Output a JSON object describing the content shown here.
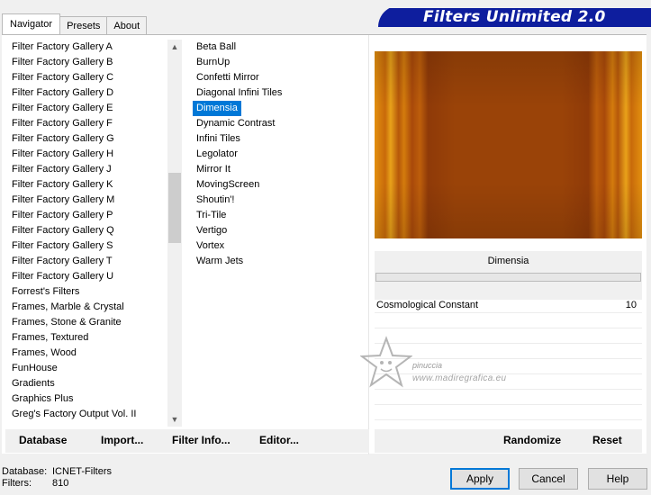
{
  "tabs": [
    {
      "label": "Navigator",
      "active": true
    },
    {
      "label": "Presets",
      "active": false
    },
    {
      "label": "About",
      "active": false
    }
  ],
  "banner": {
    "title": "Filters Unlimited 2.0",
    "color": "#0e1e9e"
  },
  "categories": [
    "Filter Factory Gallery A",
    "Filter Factory Gallery B",
    "Filter Factory Gallery C",
    "Filter Factory Gallery D",
    "Filter Factory Gallery E",
    "Filter Factory Gallery F",
    "Filter Factory Gallery G",
    "Filter Factory Gallery H",
    "Filter Factory Gallery J",
    "Filter Factory Gallery K",
    "Filter Factory Gallery M",
    "Filter Factory Gallery P",
    "Filter Factory Gallery Q",
    "Filter Factory Gallery S",
    "Filter Factory Gallery T",
    "Filter Factory Gallery U",
    "Forrest's Filters",
    "Frames, Marble & Crystal",
    "Frames, Stone & Granite",
    "Frames, Textured",
    "Frames, Wood",
    "FunHouse",
    "Gradients",
    "Graphics Plus",
    "Greg's Factory Output Vol. II"
  ],
  "filters": [
    {
      "label": "Beta Ball",
      "selected": false
    },
    {
      "label": "BurnUp",
      "selected": false
    },
    {
      "label": "Confetti Mirror",
      "selected": false
    },
    {
      "label": "Diagonal Infini Tiles",
      "selected": false
    },
    {
      "label": "Dimensia",
      "selected": true
    },
    {
      "label": "Dynamic Contrast",
      "selected": false
    },
    {
      "label": "Infini Tiles",
      "selected": false
    },
    {
      "label": "Legolator",
      "selected": false
    },
    {
      "label": "Mirror It",
      "selected": false
    },
    {
      "label": "MovingScreen",
      "selected": false
    },
    {
      "label": "Shoutin'!",
      "selected": false
    },
    {
      "label": "Tri-Tile",
      "selected": false
    },
    {
      "label": "Vertigo",
      "selected": false
    },
    {
      "label": "Vortex",
      "selected": false
    },
    {
      "label": "Warm Jets",
      "selected": false
    }
  ],
  "selected_filter": {
    "name": "Dimensia"
  },
  "parameters": [
    {
      "name": "Cosmological Constant",
      "value": "10"
    }
  ],
  "watermark": {
    "name": "pinuccia",
    "url": "www.madiregrafica.eu"
  },
  "left_bar": {
    "database": "Database",
    "import": "Import...",
    "filter_info": "Filter Info...",
    "editor": "Editor..."
  },
  "right_bar": {
    "randomize": "Randomize",
    "reset": "Reset"
  },
  "footer": {
    "database_label": "Database:",
    "database_value": "ICNET-Filters",
    "filters_label": "Filters:",
    "filters_value": "810"
  },
  "buttons": {
    "apply": "Apply",
    "cancel": "Cancel",
    "help": "Help"
  },
  "colors": {
    "selection": "#0078d7",
    "preview_dark": "#9a4308",
    "preview_light": "#e3900f"
  }
}
